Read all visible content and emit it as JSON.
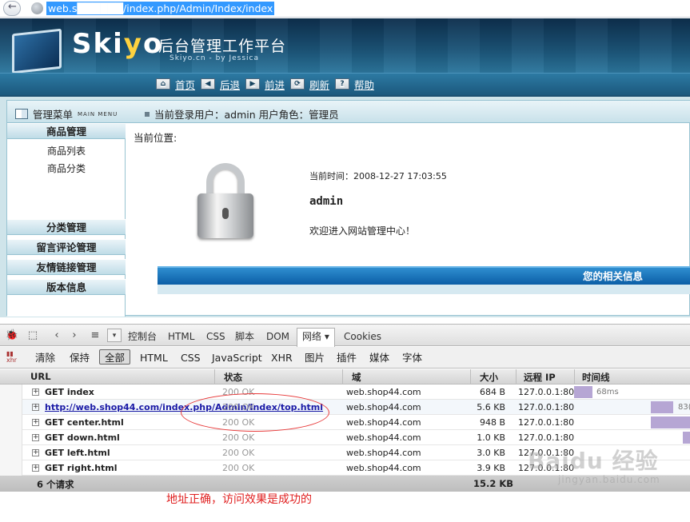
{
  "browser": {
    "url": "web.s██████/index.php/Admin/Index/index"
  },
  "banner": {
    "logo_en": "Skiyo",
    "logo_cn": "后台管理工作平台",
    "logo_sub": "Skiyo.cn - by Jessica",
    "nav": [
      {
        "label": "首页",
        "icon": "home-icon"
      },
      {
        "label": "后退",
        "icon": "back-arrow-icon"
      },
      {
        "label": "前进",
        "icon": "forward-arrow-icon"
      },
      {
        "label": "刷新",
        "icon": "refresh-icon"
      },
      {
        "label": "帮助",
        "icon": "help-icon"
      }
    ]
  },
  "app": {
    "menu_title": "管理菜单",
    "menu_small": "MAIN MENU",
    "user_label": "当前登录用户：admin  用户角色：管理员",
    "sections": [
      {
        "label": "商品管理"
      },
      {
        "label": "分类管理"
      },
      {
        "label": "留言评论管理"
      },
      {
        "label": "友情链接管理"
      },
      {
        "label": "版本信息"
      }
    ],
    "sub_items": [
      "商品列表",
      "商品分类"
    ],
    "breadcrumb": "当前位置:",
    "current_time": "当前时间：2008-12-27 17:03:55",
    "admin": "admin",
    "welcome": "欢迎进入网站管理中心！",
    "info_bar": "您的相关信息"
  },
  "devtools": {
    "tabs": [
      "控制台",
      "HTML",
      "CSS",
      "脚本",
      "DOM",
      "网络 ▾",
      "Cookies"
    ],
    "active_tab": "网络 ▾",
    "filters": [
      "清除",
      "保持",
      "全部",
      "HTML",
      "CSS",
      "JavaScript",
      "XHR",
      "图片",
      "插件",
      "媒体",
      "字体"
    ],
    "xhr_label": "xhr",
    "columns": {
      "url": "URL",
      "status": "状态",
      "domain": "域",
      "size": "大小",
      "ip": "远程 IP",
      "timeline": "时间线"
    },
    "rows": [
      {
        "url": "GET index",
        "status": "200 OK",
        "domain": "web.shop44.com",
        "size": "684 B",
        "ip": "127.0.0.1:80",
        "time_label": "68ms"
      },
      {
        "url": "http://web.shop44.com/index.php/Admin/Index/top.html",
        "status": "200 OK",
        "domain": "web.shop44.com",
        "size": "5.6 KB",
        "ip": "127.0.0.1:80",
        "time_label": "83("
      },
      {
        "url": "GET center.html",
        "status": "200 OK",
        "domain": "web.shop44.com",
        "size": "948 B",
        "ip": "127.0.0.1:80",
        "time_label": ""
      },
      {
        "url": "GET down.html",
        "status": "200 OK",
        "domain": "web.shop44.com",
        "size": "1.0 KB",
        "ip": "127.0.0.1:80",
        "time_label": ""
      },
      {
        "url": "GET left.html",
        "status": "200 OK",
        "domain": "web.shop44.com",
        "size": "3.0 KB",
        "ip": "127.0.0.1:80",
        "time_label": ""
      },
      {
        "url": "GET right.html",
        "status": "200 OK",
        "domain": "web.shop44.com",
        "size": "3.9 KB",
        "ip": "127.0.0.1:80",
        "time_label": ""
      }
    ],
    "summary_count": "6 个请求",
    "summary_total": "15.2 KB"
  },
  "annotation": "地址正确，访问效果是成功的",
  "watermark": "Baidu 经验",
  "watermark_sub": "jingyan.baidu.com"
}
